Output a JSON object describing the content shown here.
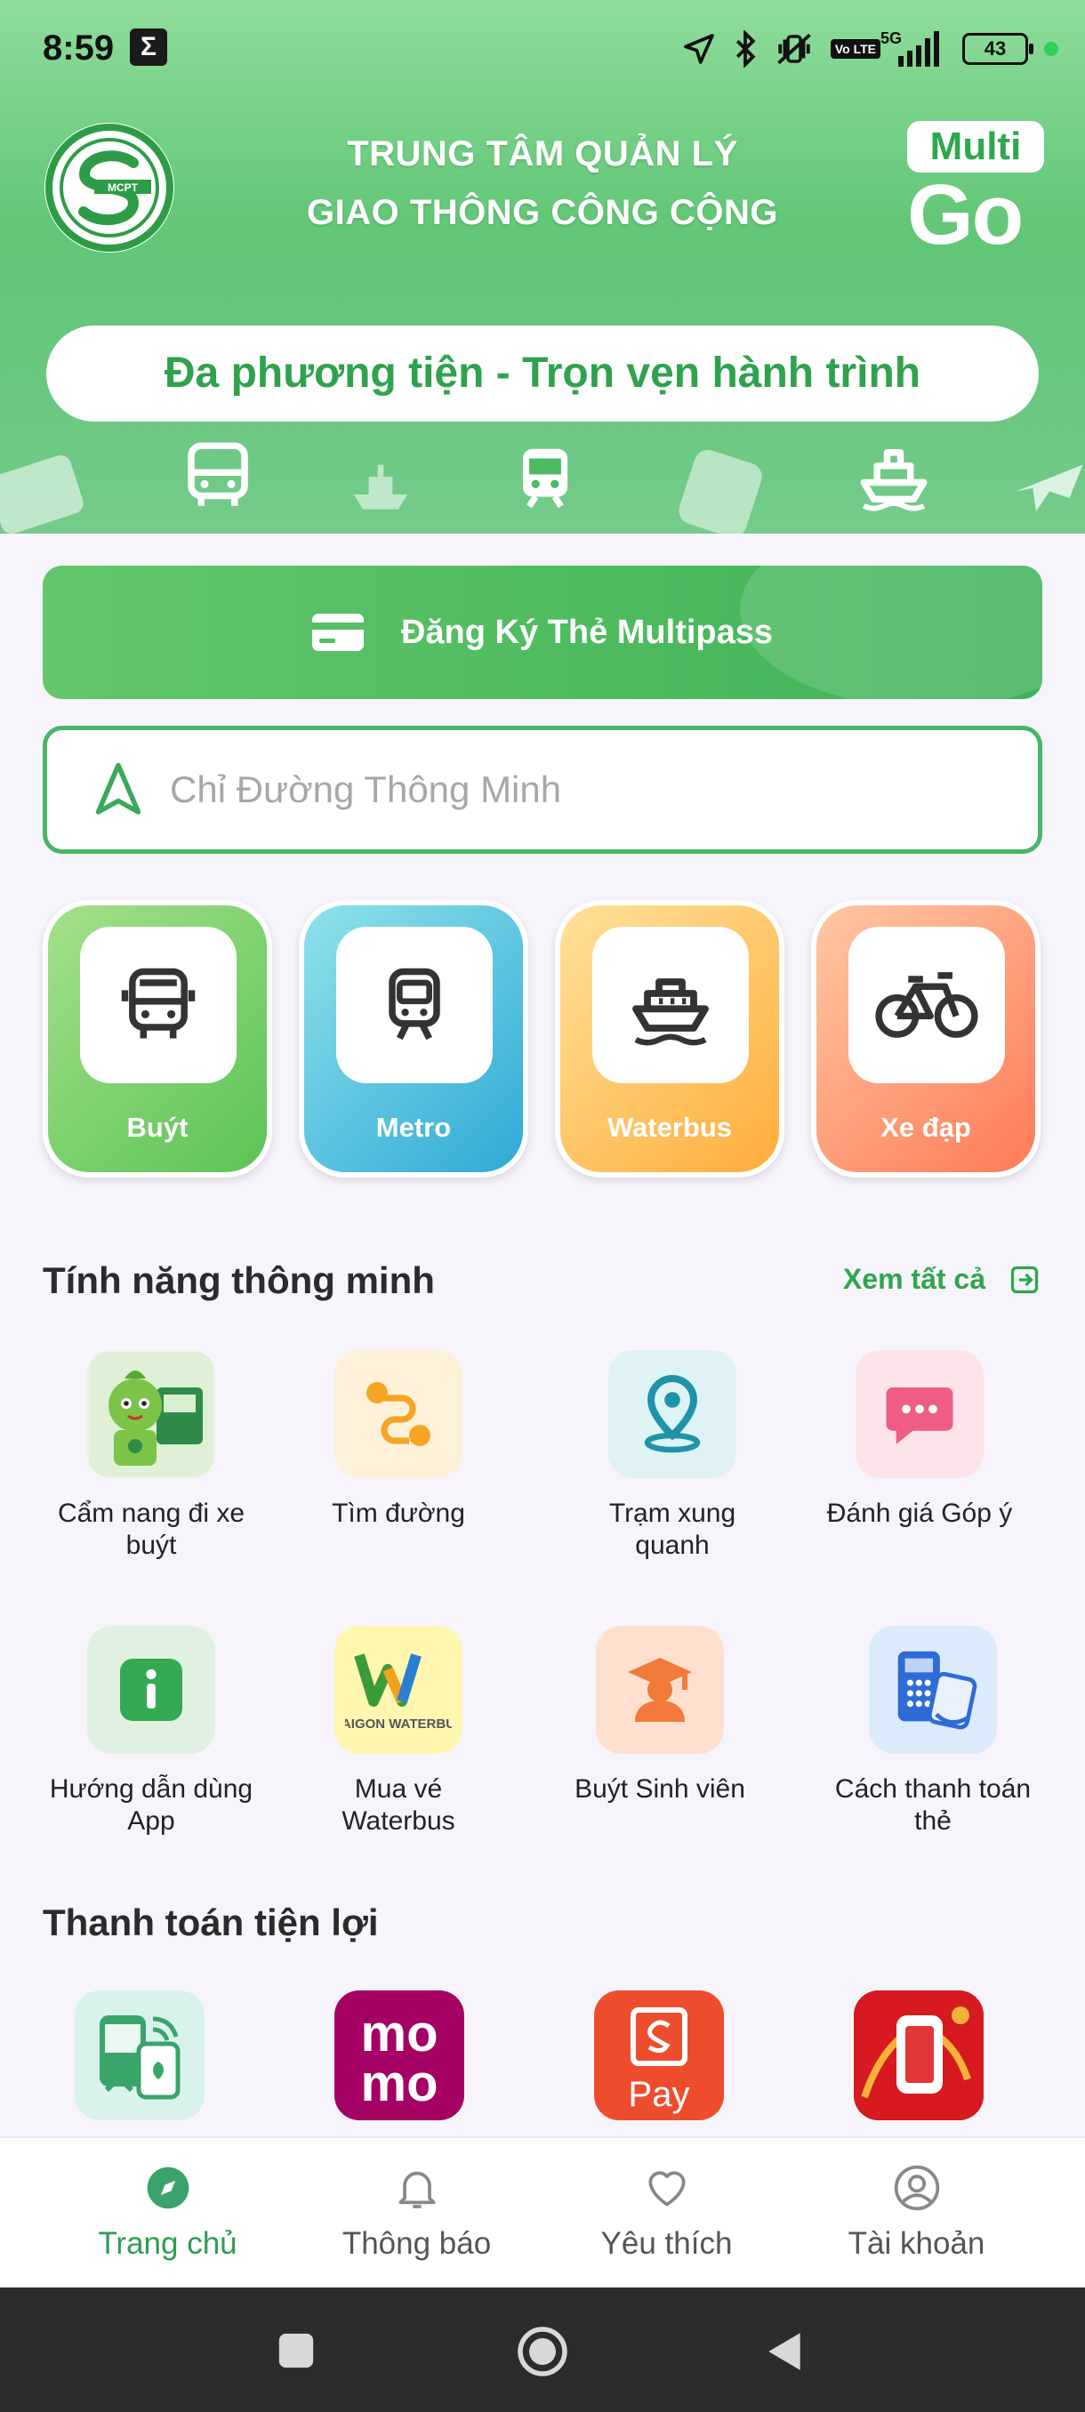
{
  "status_bar": {
    "time": "8:59",
    "network": "5G",
    "volte": "Vo LTE",
    "battery": "43"
  },
  "header": {
    "org_line1": "TRUNG TÂM QUẢN LÝ",
    "org_line2": "GIAO THÔNG CÔNG CỘNG",
    "logo_text": "MCPT",
    "brand_top": "Multi",
    "brand_bottom": "Go",
    "slogan": "Đa phương tiện - Trọn vẹn hành trình"
  },
  "multipass_button": "Đăng Ký Thẻ Multipass",
  "search": {
    "placeholder": "Chỉ Đường Thông Minh"
  },
  "modes": [
    {
      "label": "Buýt",
      "icon": "bus-icon"
    },
    {
      "label": "Metro",
      "icon": "metro-icon"
    },
    {
      "label": "Waterbus",
      "icon": "ship-icon"
    },
    {
      "label": "Xe đạp",
      "icon": "bicycle-icon"
    }
  ],
  "smart_features": {
    "title": "Tính năng thông minh",
    "see_all": "Xem tất cả",
    "items": [
      {
        "label": "Cẩm nang đi xe buýt",
        "icon": "handbook-mascot-icon"
      },
      {
        "label": "Tìm đường",
        "icon": "route-icon"
      },
      {
        "label": "Trạm xung quanh",
        "icon": "location-pin-icon"
      },
      {
        "label": "Đánh giá Góp ý",
        "icon": "chat-bubble-icon"
      },
      {
        "label": "Hướng dẫn dùng App",
        "icon": "info-icon"
      },
      {
        "label": "Mua vé Waterbus",
        "icon": "waterbus-logo-icon",
        "logo_text": "SAIGON WATERBUS"
      },
      {
        "label": "Buýt Sinh viên",
        "icon": "student-icon"
      },
      {
        "label": "Cách thanh toán thẻ",
        "icon": "card-payment-icon"
      }
    ]
  },
  "payments": {
    "title": "Thanh toán tiện lợi",
    "items": [
      {
        "name": "tap-to-pay",
        "icon": "phone-tap-icon"
      },
      {
        "name": "momo",
        "icon": "momo-icon",
        "text_top": "mo",
        "text_bottom": "mo"
      },
      {
        "name": "shopeepay",
        "icon": "shopeepay-icon",
        "text": "Pay"
      },
      {
        "name": "phone-payment",
        "icon": "phone-dragon-icon"
      }
    ]
  },
  "bottom_nav": [
    {
      "label": "Trang chủ",
      "icon": "compass-icon",
      "active": true
    },
    {
      "label": "Thông báo",
      "icon": "bell-icon"
    },
    {
      "label": "Yêu thích",
      "icon": "heart-icon"
    },
    {
      "label": "Tài khoản",
      "icon": "account-icon"
    }
  ],
  "colors": {
    "primary": "#45b765",
    "accent_text": "#2fa64d",
    "nav_active": "#2e9c55"
  }
}
